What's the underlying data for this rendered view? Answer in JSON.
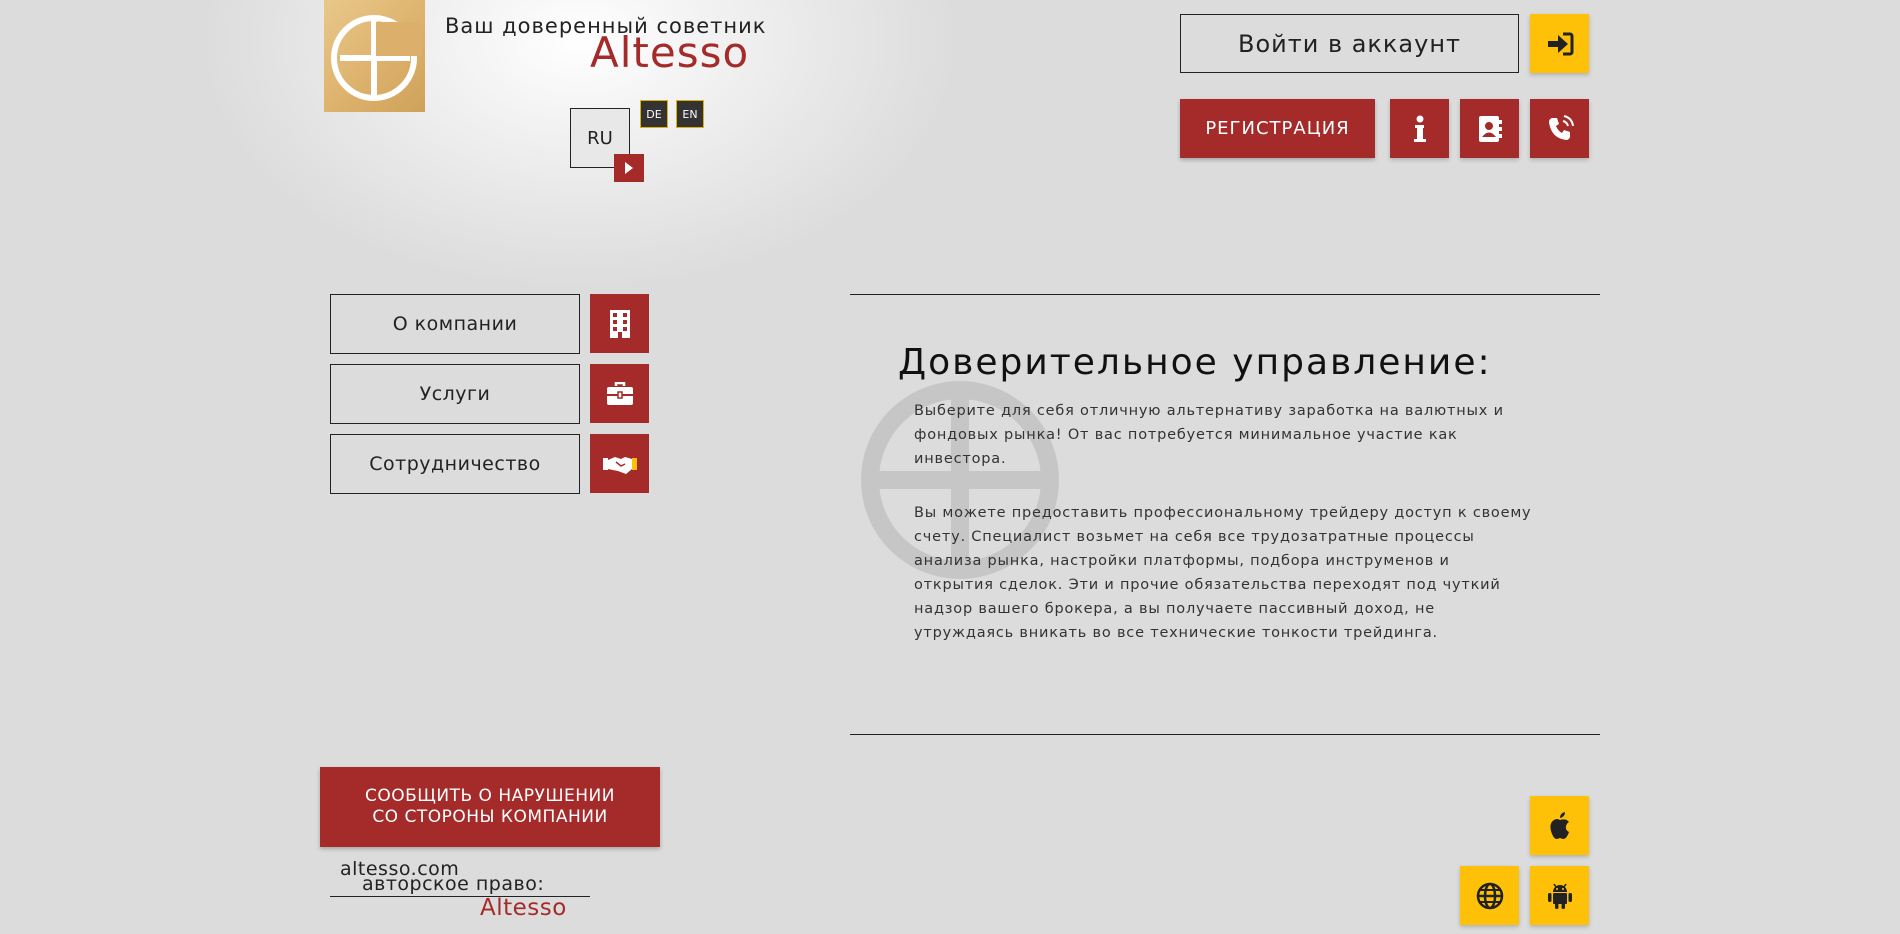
{
  "header": {
    "tagline": "Ваш доверенный советник",
    "brand": "Altesso"
  },
  "language": {
    "current": "RU",
    "options": [
      "DE",
      "EN"
    ]
  },
  "account": {
    "login_label": "Войти в аккаунт",
    "register_label": "РЕГИСТРАЦИЯ"
  },
  "nav": {
    "items": [
      {
        "label": "О компании",
        "icon": "building-icon"
      },
      {
        "label": "Услуги",
        "icon": "briefcase-icon"
      },
      {
        "label": "Сотрудничество",
        "icon": "handshake-icon"
      }
    ]
  },
  "content": {
    "title": "Доверительное управление:",
    "paragraph1": "Выберите для себя отличную альтернативу заработка на валютных и фондовых рынка! От вас потребуется минимальное участие как инвестора.",
    "paragraph2": "Вы можете предоставить профессиональному трейдеру доступ к своему счету. Специалист возьмет на себя все трудозатратные процессы анализа рынка, настройки платформы, подбора инструменов и открытия сделок. Эти и прочие обязательства переходят под чуткий надзор вашего брокера, а вы получаете пассивный доход, не утруждаясь вникать во все технические тонкости трейдинга."
  },
  "report": {
    "line1": "СООБЩИТЬ О НАРУШЕНИИ",
    "line2": "СО СТОРОНЫ КОМПАНИИ"
  },
  "footer": {
    "domain": "altesso.com",
    "copyright_label": "авторское право:",
    "brand": "Altesso"
  },
  "apps": [
    "apple-icon",
    "globe-icon",
    "android-icon"
  ],
  "colors": {
    "accent_red": "#a52a2a",
    "accent_yellow": "#ffc107",
    "logo_gold": "#dcb06a",
    "background": "#dcdcdc"
  }
}
